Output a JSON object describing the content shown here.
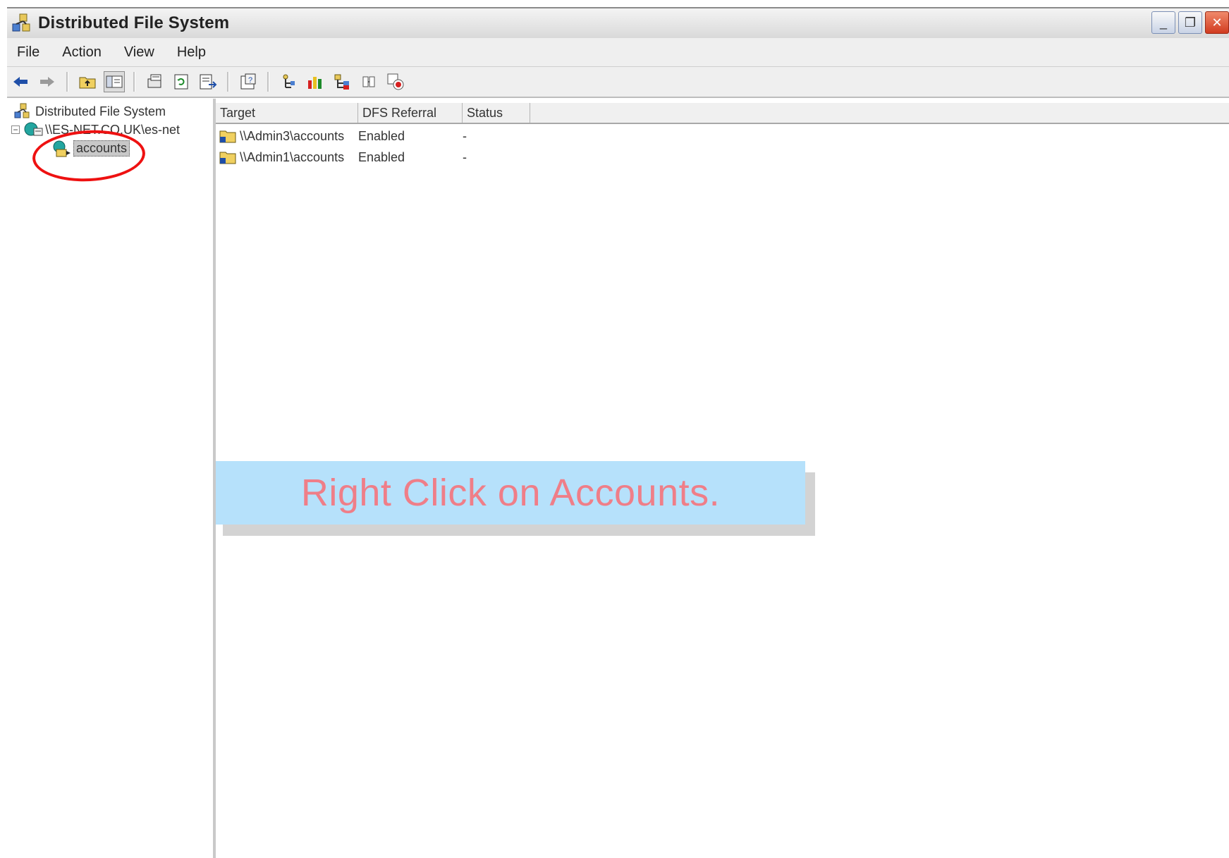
{
  "window": {
    "title": "Distributed File System",
    "controls": [
      "minimize",
      "restore",
      "close"
    ]
  },
  "menubar": {
    "items": [
      "File",
      "Action",
      "View",
      "Help"
    ]
  },
  "toolbar": {
    "icons": [
      "back-icon",
      "forward-icon",
      "up-folder-icon",
      "show-hide-tree-icon",
      "export-icon",
      "refresh-icon",
      "export-list-icon",
      "properties-icon",
      "new-root-icon",
      "status-chart-icon",
      "new-link-icon",
      "replication-icon",
      "check-status-icon"
    ]
  },
  "tree": {
    "root_label": "Distributed File System",
    "dfs_root_label": "\\\\ES-NET.CO.UK\\es-net",
    "link_label": "accounts"
  },
  "list": {
    "columns": [
      "Target",
      "DFS Referral",
      "Status"
    ],
    "rows": [
      {
        "target": "\\\\Admin3\\accounts",
        "referral": "Enabled",
        "status": "-"
      },
      {
        "target": "\\\\Admin1\\accounts",
        "referral": "Enabled",
        "status": "-"
      }
    ]
  },
  "annotation": {
    "text": "Right Click on Accounts.",
    "color": "#ef7e88",
    "background": "#b6e1fb",
    "highlight_color": "#e11111"
  }
}
